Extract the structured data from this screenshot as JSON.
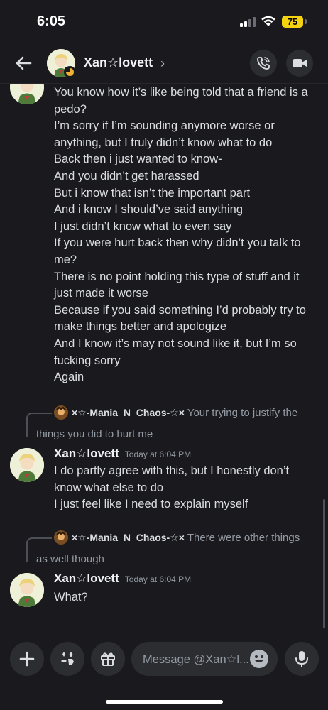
{
  "status_bar": {
    "time": "6:05",
    "battery": "75"
  },
  "header": {
    "name": "Xan☆lovett",
    "chevron": "›"
  },
  "messages": {
    "first_block": [
      "You know how it’s like being told that a friend is a",
      "pedo?",
      "I’m sorry if I’m sounding  anymore worse or",
      "anything, but I truly didn’t know what to do",
      "Back then i just wanted to know-",
      "And you didn’t get harassed",
      "But i know that isn’t the important part",
      "And i know I should’ve said anything",
      "I just didn’t know what to even say",
      "If you were hurt back then why didn’t you talk to",
      "me?",
      "There is no point holding this type of stuff and it",
      "just made it worse",
      "Because if you said something I’d probably try to",
      "make things better and apologize",
      "And I know it’s may not sound like it, but I’m so",
      "fucking sorry",
      "Again"
    ],
    "reply1": {
      "name": "×☆-Mania_N_Chaos-☆×",
      "text1": "Your trying to justify the",
      "text2": "things you did to hurt me"
    },
    "msg2": {
      "author": "Xan☆lovett",
      "time": "Today at 6:04 PM",
      "lines": [
        "I do partly agree with this, but I honestly don’t",
        "know what else to do",
        "I just feel like I need to explain myself"
      ]
    },
    "reply2": {
      "name": "×☆-Mania_N_Chaos-☆×",
      "text1": "There were other things",
      "text2": "as well though"
    },
    "msg3": {
      "author": "Xan☆lovett",
      "time": "Today at 6:04 PM",
      "lines": [
        "What?"
      ]
    }
  },
  "composer": {
    "placeholder": "Message @Xan☆l..."
  },
  "icons": {
    "back": "arrow-left-icon",
    "call": "phone-icon",
    "video": "video-camera-icon",
    "add": "plus-icon",
    "apps": "apps-icon",
    "gift": "gift-icon",
    "emoji": "emoji-icon",
    "mic": "microphone-icon"
  },
  "colors": {
    "background": "#1a1a1e",
    "surface": "#2b2d31",
    "text": "#dbdee1",
    "muted": "#949ba4",
    "battery": "#f5d30e",
    "idle": "#f0b232"
  }
}
